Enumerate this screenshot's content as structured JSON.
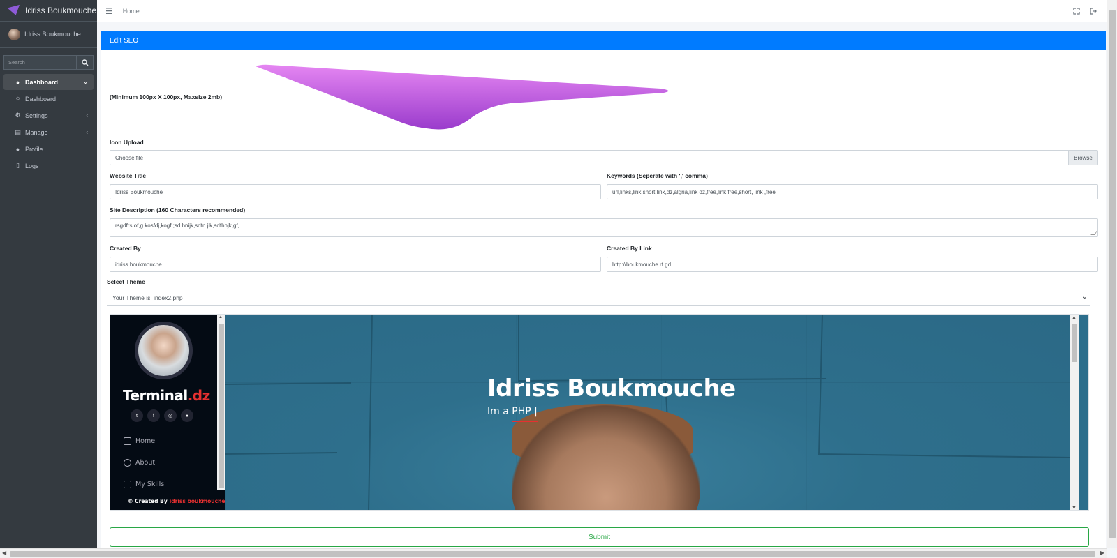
{
  "brand": {
    "name": "Idriss Boukmouche"
  },
  "user": {
    "name": "Idriss Boukmouche"
  },
  "sidebar": {
    "search_placeholder": "Search",
    "items": [
      {
        "label": "Dashboard",
        "icon": "tachometer-icon",
        "active": true
      },
      {
        "label": "Dashboard",
        "icon": "circle-icon"
      },
      {
        "label": "Settings",
        "icon": "gear-icon"
      },
      {
        "label": "Manage",
        "icon": "clipboard-icon"
      },
      {
        "label": "Profile",
        "icon": "user-icon"
      },
      {
        "label": "Logs",
        "icon": "file-icon"
      }
    ]
  },
  "topbar": {
    "home_label": "Home"
  },
  "card": {
    "title": "Edit SEO",
    "logo_note": "(Minimum 100px X 100px, Maxsize 2mb)",
    "icon_upload_label": "Icon Upload",
    "file_placeholder": "Choose file",
    "browse_label": "Browse",
    "website_title_label": "Website Title",
    "website_title_value": "Idriss Boukmouche",
    "keywords_label": "Keywords (Seperate with ',' comma)",
    "keywords_value": "url,links,link,short link,dz,algria,link dz,free,link free,short, link ,free",
    "description_label": "Site Description (160 Characters recommended)",
    "description_value": "rsgdfrs of,g kosfdj,kogf,;sd hnijk,sdfn jik,sdfhnjk,gf,",
    "created_by_label": "Created By",
    "created_by_value": "idriss boukmouche",
    "created_by_link_label": "Created By Link",
    "created_by_link_value": "http://boukmouche.rf.gd",
    "select_theme_label": "Select Theme",
    "theme_value": "Your Theme is: index2.php",
    "submit_label": "Submit"
  },
  "preview": {
    "brand_main": "Terminal",
    "brand_accent": ".dz",
    "socials": [
      "twitter-icon",
      "facebook-icon",
      "instagram-icon",
      "github-icon"
    ],
    "nav": [
      "Home",
      "About",
      "My Skills"
    ],
    "footer_prefix": "© Created By",
    "footer_name": "idriss boukmouche",
    "hero_title": "Idriss Boukmouche",
    "hero_sub": "Im a PHP |"
  },
  "colors": {
    "accent": "#007bff",
    "sidebar_bg": "#343a40",
    "submit": "#28a745",
    "brand_red": "#e63030"
  }
}
